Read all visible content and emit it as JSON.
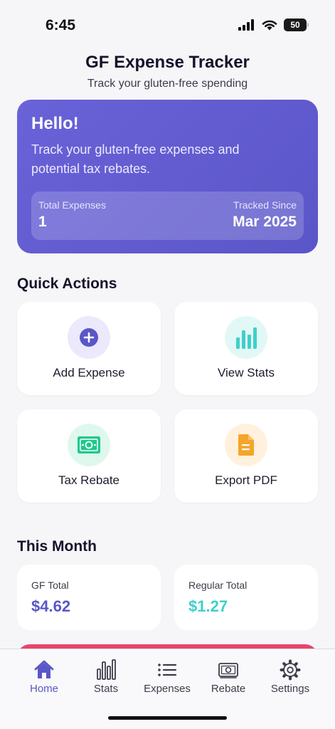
{
  "status": {
    "time": "6:45",
    "battery": "50"
  },
  "header": {
    "title": "GF Expense Tracker",
    "subtitle": "Track your gluten-free spending"
  },
  "hero": {
    "greeting": "Hello!",
    "description": "Track your gluten-free expenses and potential tax rebates.",
    "total_label": "Total Expenses",
    "total_value": "1",
    "since_label": "Tracked Since",
    "since_value": "Mar 2025"
  },
  "quick_actions": {
    "title": "Quick Actions",
    "items": [
      {
        "label": "Add Expense",
        "icon": "plus-circle-icon"
      },
      {
        "label": "View Stats",
        "icon": "bar-chart-icon"
      },
      {
        "label": "Tax Rebate",
        "icon": "cash-icon"
      },
      {
        "label": "Export PDF",
        "icon": "document-icon"
      }
    ]
  },
  "this_month": {
    "title": "This Month",
    "gf_label": "GF Total",
    "gf_value": "$4.62",
    "regular_label": "Regular Total",
    "regular_value": "$1.27"
  },
  "tabs": [
    {
      "label": "Home",
      "icon": "home-icon",
      "active": true
    },
    {
      "label": "Stats",
      "icon": "bar-chart-icon"
    },
    {
      "label": "Expenses",
      "icon": "list-icon"
    },
    {
      "label": "Rebate",
      "icon": "cash-icon"
    },
    {
      "label": "Settings",
      "icon": "gear-icon"
    }
  ],
  "colors": {
    "primary": "#5a56c8",
    "teal": "#3fd0c9",
    "green": "#1fc98e",
    "orange": "#f5a52a",
    "peek": "#e8456c"
  }
}
